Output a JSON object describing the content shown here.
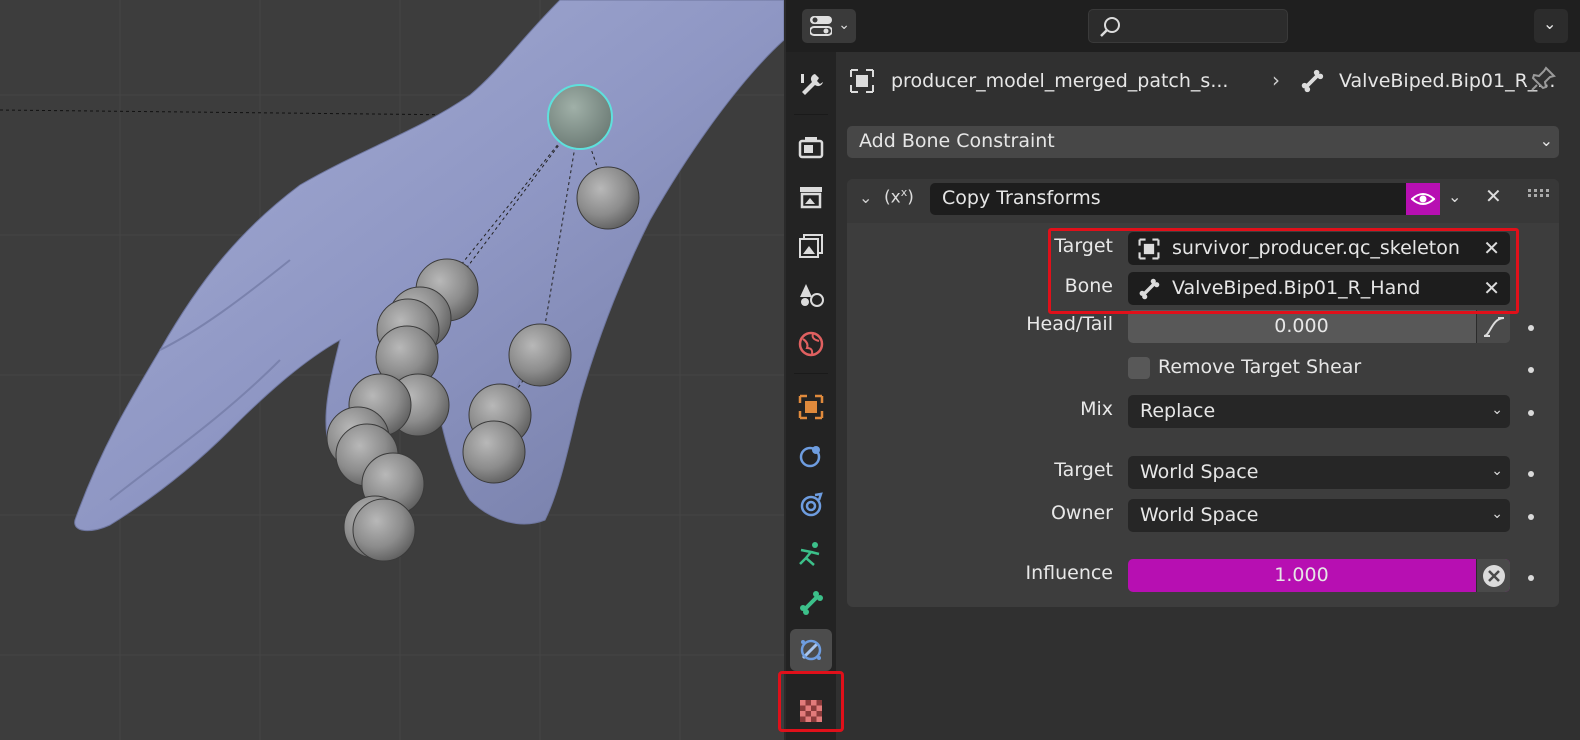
{
  "topbar": {
    "search_placeholder": ""
  },
  "breadcrumb": {
    "object_name": "producer_model_merged_patch_s...",
    "bone_name": "ValveBiped.Bip01_R_..."
  },
  "add_constraint": {
    "label": "Add Bone Constraint"
  },
  "constraint": {
    "name": "Copy Transforms",
    "target_label": "Target",
    "target_value": "survivor_producer.qc_skeleton",
    "bone_label": "Bone",
    "bone_value": "ValveBiped.Bip01_R_Hand",
    "headtail_label": "Head/Tail",
    "headtail_value": "0.000",
    "remove_shear_label": "Remove Target Shear",
    "remove_shear_checked": false,
    "mix_label": "Mix",
    "mix_value": "Replace",
    "target_space_label": "Target",
    "target_space_value": "World Space",
    "owner_space_label": "Owner",
    "owner_space_value": "World Space",
    "influence_label": "Influence",
    "influence_value": "1.000"
  },
  "tabs": [
    {
      "icon": "tool-icon"
    },
    {
      "icon": "render-icon"
    },
    {
      "icon": "output-icon"
    },
    {
      "icon": "view-layer-icon"
    },
    {
      "icon": "scene-icon"
    },
    {
      "icon": "world-icon"
    },
    {
      "icon": "object-icon"
    },
    {
      "icon": "modifier-icon"
    },
    {
      "icon": "physics-icon"
    },
    {
      "icon": "object-data-icon"
    },
    {
      "icon": "bone-icon"
    },
    {
      "icon": "bone-constraint-icon",
      "active": true
    },
    {
      "icon": "texture-icon"
    }
  ],
  "colors": {
    "accent": "#b70fb2",
    "highlight_box": "#e0101a",
    "mesh": "#8e96c4",
    "selected_bone_outline": "#5ee0dc"
  }
}
